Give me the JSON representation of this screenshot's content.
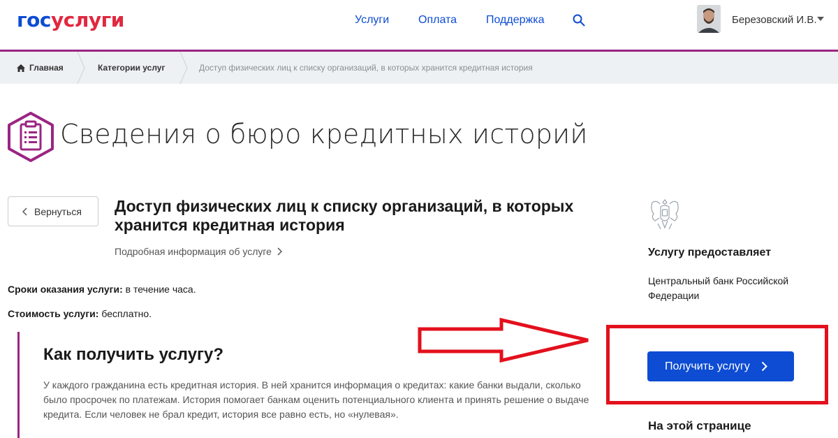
{
  "header": {
    "logo_part1": "гос",
    "logo_part2": "услуги",
    "nav": [
      "Услуги",
      "Оплата",
      "Поддержка"
    ],
    "user_name": "Березовский И.В.",
    "icons": {
      "search": "search-icon",
      "user_menu": "chevron-down-icon"
    }
  },
  "breadcrumb": {
    "home": "Главная",
    "category": "Категории услуг",
    "current": "Доступ физических лиц к списку организаций, в которых хранится кредитная история"
  },
  "page": {
    "title": "Сведения о бюро кредитных историй",
    "back_label": "Вернуться",
    "service_title": "Доступ физических лиц к списку организаций, в которых хранится кредитная история",
    "more_info": "Подробная информация об услуге",
    "terms_label": "Сроки оказания услуги:",
    "terms_value": " в течение часа.",
    "cost_label": "Стоимость услуги:",
    "cost_value": " бесплатно."
  },
  "howto": {
    "title": "Как получить услугу?",
    "text": "У каждого гражданина есть кредитная история. В ней хранится информация о кредитах: какие банки выдали, сколько было просрочек по платежам. История помогает банкам оценить потенциального клиента и принять решение о выдаче кредита. Если человек не брал кредит, история все равно есть, но «нулевая»."
  },
  "sidebar": {
    "provider_label": "Услугу предоставляет",
    "provider_name": "Центральный банк Российской Федерации",
    "get_button": "Получить услугу",
    "on_page": "На этой странице"
  },
  "colors": {
    "brand_blue": "#0d4cd3",
    "brand_red": "#e1283f",
    "accent_purple": "#9b2582",
    "annotation_red": "#e3101d"
  }
}
